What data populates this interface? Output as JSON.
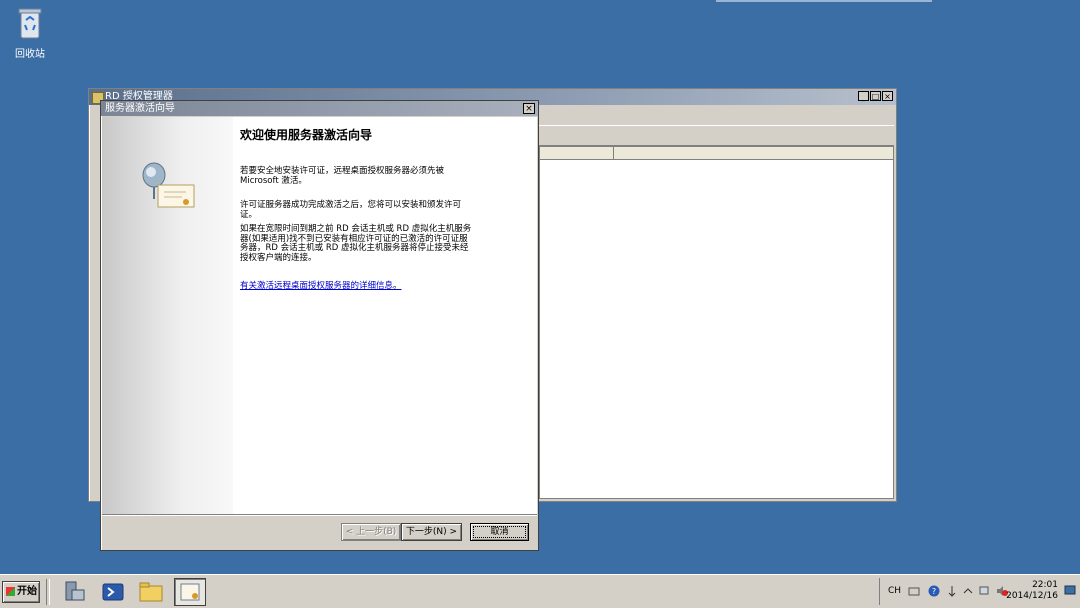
{
  "desktop": {
    "recycle_bin_label": "回收站"
  },
  "back_window": {
    "title": "RD 授权管理器",
    "minimize": "_",
    "maximize": "□",
    "close": "×"
  },
  "wizard": {
    "title": "服务器激活向导",
    "close_label": "×",
    "heading": "欢迎使用服务器激活向导",
    "para1": "若要安全地安装许可证，远程桌面授权服务器必须先被 Microsoft 激活。",
    "para2": "许可证服务器成功完成激活之后，您将可以安装和颁发许可证。",
    "para3": "如果在宽限时间到期之前 RD 会话主机或 RD 虚拟化主机服务器(如果适用)找不到已安装有相应许可证的已激活的许可证服务器，RD 会话主机或 RD 虚拟化主机服务器将停止接受未经授权客户端的连接。",
    "link": "有关激活远程桌面授权服务器的详细信息",
    "link_suffix": "。",
    "back_button": "< 上一步(B)",
    "next_button": "下一步(N) >",
    "cancel_button": "取消"
  },
  "taskbar": {
    "start_label": "开始",
    "lang": "CH",
    "time": "22:01",
    "date": "2014/12/16"
  }
}
